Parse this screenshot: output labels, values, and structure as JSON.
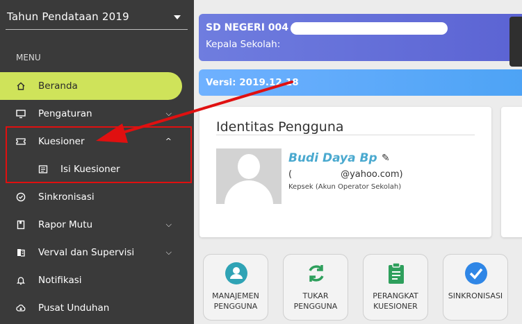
{
  "sidebar": {
    "year_select": "Tahun Pendataan 2019",
    "menu_label": "MENU",
    "items": [
      {
        "label": "Beranda",
        "icon": "home-icon",
        "active": true
      },
      {
        "label": "Pengaturan",
        "icon": "monitor-icon",
        "chevron": "down"
      },
      {
        "label": "Kuesioner",
        "icon": "ticket-icon",
        "chevron": "up"
      },
      {
        "label": "Isi Kuesioner",
        "icon": "form-icon",
        "sub": true
      },
      {
        "label": "Sinkronisasi",
        "icon": "check-circle-icon"
      },
      {
        "label": "Rapor Mutu",
        "icon": "book-icon",
        "chevron": "down"
      },
      {
        "label": "Verval dan Supervisi",
        "icon": "clipboard-icon",
        "chevron": "down"
      },
      {
        "label": "Notifikasi",
        "icon": "bell-icon"
      },
      {
        "label": "Pusat Unduhan",
        "icon": "cloud-download-icon"
      }
    ]
  },
  "header": {
    "school_name": "SD NEGERI 004",
    "role": "Kepala Sekolah:",
    "version": "Versi: 2019.12.18"
  },
  "identity": {
    "title": "Identitas Pengguna",
    "name": "Budi Daya Bp",
    "email_open": "(",
    "email_rest": "@yahoo.com)",
    "role": "Kepsek (Akun Operator Sekolah)"
  },
  "actions": [
    {
      "label": "MANAJEMEN\nPENGGUNA",
      "icon": "user-icon"
    },
    {
      "label": "TUKAR\nPENGGUNA",
      "icon": "swap-icon"
    },
    {
      "label": "PERANGKAT\nKUESIONER",
      "icon": "clipboard-list-icon"
    },
    {
      "label": "SINKRONISASI",
      "icon": "check-circle-icon"
    }
  ],
  "colors": {
    "sidebar_bg": "#3a3a3a",
    "active_item": "#cfe35a",
    "school_card": "#6f7ddf",
    "version_card": "#5aa8f7",
    "accent_name": "#4aa9cf",
    "icon_teal": "#2fa3b5",
    "icon_green": "#2e9f5c",
    "icon_blue": "#2f86e6",
    "annotation_red": "#e01010"
  }
}
